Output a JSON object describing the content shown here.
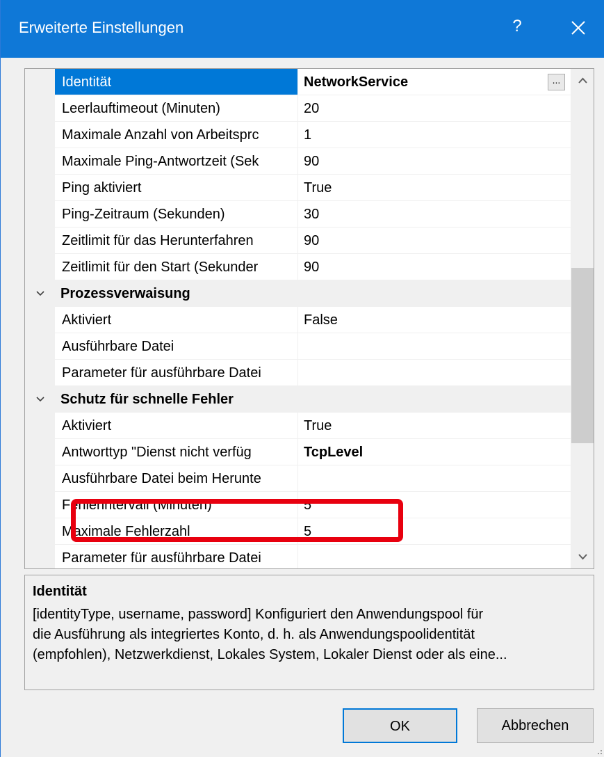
{
  "window": {
    "title": "Erweiterte Einstellungen",
    "help_label": "?",
    "accent_color": "#0f78d7"
  },
  "grid": {
    "rows": [
      {
        "kind": "property",
        "name": "Identität",
        "value": "NetworkService",
        "selected": true,
        "bold_value": true,
        "has_ellipsis": true
      },
      {
        "kind": "property",
        "name": "Leerlauftimeout (Minuten)",
        "value": "20"
      },
      {
        "kind": "property",
        "name": "Maximale Anzahl von Arbeitsprc",
        "value": "1"
      },
      {
        "kind": "property",
        "name": "Maximale Ping-Antwortzeit (Sek",
        "value": "90"
      },
      {
        "kind": "property",
        "name": "Ping aktiviert",
        "value": "True"
      },
      {
        "kind": "property",
        "name": "Ping-Zeitraum (Sekunden)",
        "value": "30"
      },
      {
        "kind": "property",
        "name": "Zeitlimit für das Herunterfahren",
        "value": "90"
      },
      {
        "kind": "property",
        "name": "Zeitlimit für den Start (Sekunder",
        "value": "90"
      },
      {
        "kind": "category",
        "name": "Prozessverwaisung"
      },
      {
        "kind": "property",
        "name": "Aktiviert",
        "value": "False"
      },
      {
        "kind": "property",
        "name": "Ausführbare Datei",
        "value": ""
      },
      {
        "kind": "property",
        "name": "Parameter für ausführbare Datei",
        "value": ""
      },
      {
        "kind": "category",
        "name": "Schutz für schnelle Fehler"
      },
      {
        "kind": "property",
        "name": "Aktiviert",
        "value": "True"
      },
      {
        "kind": "property",
        "name": "Antworttyp \"Dienst nicht verfüg",
        "value": "TcpLevel",
        "bold_value": true,
        "highlighted": true
      },
      {
        "kind": "property",
        "name": "Ausführbare Datei beim Herunte",
        "value": ""
      },
      {
        "kind": "property",
        "name": "Fehlerintervall (Minuten)",
        "value": "5"
      },
      {
        "kind": "property",
        "name": "Maximale Fehlerzahl",
        "value": "5"
      },
      {
        "kind": "property",
        "name": "Parameter für ausführbare Datei",
        "value": ""
      }
    ],
    "ellipsis_label": "...",
    "highlight_color": "#e8000f",
    "selection_color": "#0078d7"
  },
  "description": {
    "heading": "Identität",
    "text": "[identityType, username, password] Konfiguriert den Anwendungspool für\ndie Ausführung als integriertes Konto, d. h. als Anwendungspoolidentität\n(empfohlen), Netzwerkdienst, Lokales System, Lokaler Dienst oder als eine..."
  },
  "buttons": {
    "ok": "OK",
    "cancel": "Abbrechen"
  }
}
